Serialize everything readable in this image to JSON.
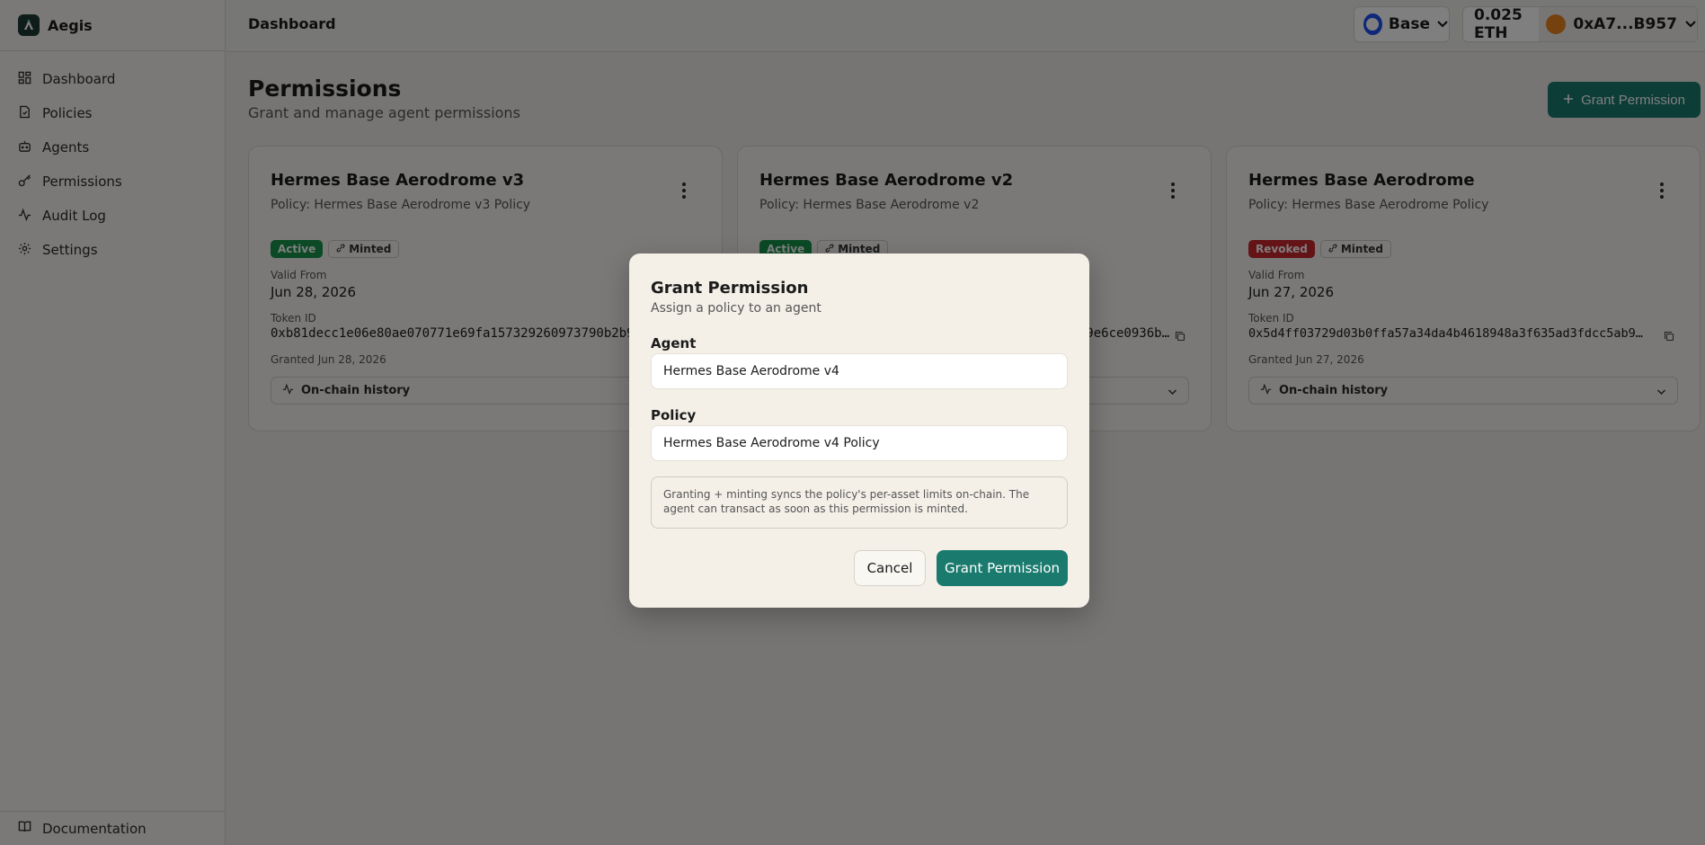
{
  "app": {
    "name": "Aegis"
  },
  "sidebar": {
    "items": [
      {
        "label": "Dashboard",
        "icon": "grid-icon"
      },
      {
        "label": "Policies",
        "icon": "file-icon"
      },
      {
        "label": "Agents",
        "icon": "bot-icon"
      },
      {
        "label": "Permissions",
        "icon": "key-icon"
      },
      {
        "label": "Audit Log",
        "icon": "activity-icon"
      },
      {
        "label": "Settings",
        "icon": "gear-icon"
      }
    ],
    "footer_label": "Documentation"
  },
  "topbar": {
    "title": "Dashboard",
    "chain": "Base",
    "balance": "0.025 ETH",
    "account": "0xA7...B957"
  },
  "page": {
    "title": "Permissions",
    "subtitle": "Grant and manage agent permissions",
    "grant_button": "Grant Permission"
  },
  "card_labels": {
    "valid_from": "Valid From",
    "token_id": "Token ID",
    "history": "On-chain history",
    "minted": "Minted"
  },
  "cards": [
    {
      "title": "Hermes Base Aerodrome v3",
      "policy": "Policy: Hermes Base Aerodrome v3 Policy",
      "status": "Active",
      "valid_from": "Jun 28, 2026",
      "token_id": "0xb81decc1e06e80ae070771e69fa157329260973790b2b9",
      "granted": "Granted Jun 28, 2026"
    },
    {
      "title": "Hermes Base Aerodrome v2",
      "policy": "Policy: Hermes Base Aerodrome v2",
      "status": "Active",
      "valid_from": "",
      "token_id": "9e6ce0936b…",
      "granted": ""
    },
    {
      "title": "Hermes Base Aerodrome",
      "policy": "Policy: Hermes Base Aerodrome Policy",
      "status": "Revoked",
      "valid_from": "Jun 27, 2026",
      "token_id": "0x5d4ff03729d03b0ffa57a34da4b4618948a3f635ad3fdcc5ab9…",
      "granted": "Granted Jun 27, 2026"
    }
  ],
  "modal": {
    "title": "Grant Permission",
    "subtitle": "Assign a policy to an agent",
    "agent_label": "Agent",
    "agent_value": "Hermes Base Aerodrome v4",
    "policy_label": "Policy",
    "policy_value": "Hermes Base Aerodrome v4 Policy",
    "note": "Granting + minting syncs the policy's per-asset limits on-chain. The agent can transact as soon as this permission is minted.",
    "cancel": "Cancel",
    "confirm": "Grant Permission"
  },
  "colors": {
    "accent": "#1a7a6e",
    "active": "#16944a",
    "revoked": "#c8262e",
    "chain": "#2151f5"
  }
}
